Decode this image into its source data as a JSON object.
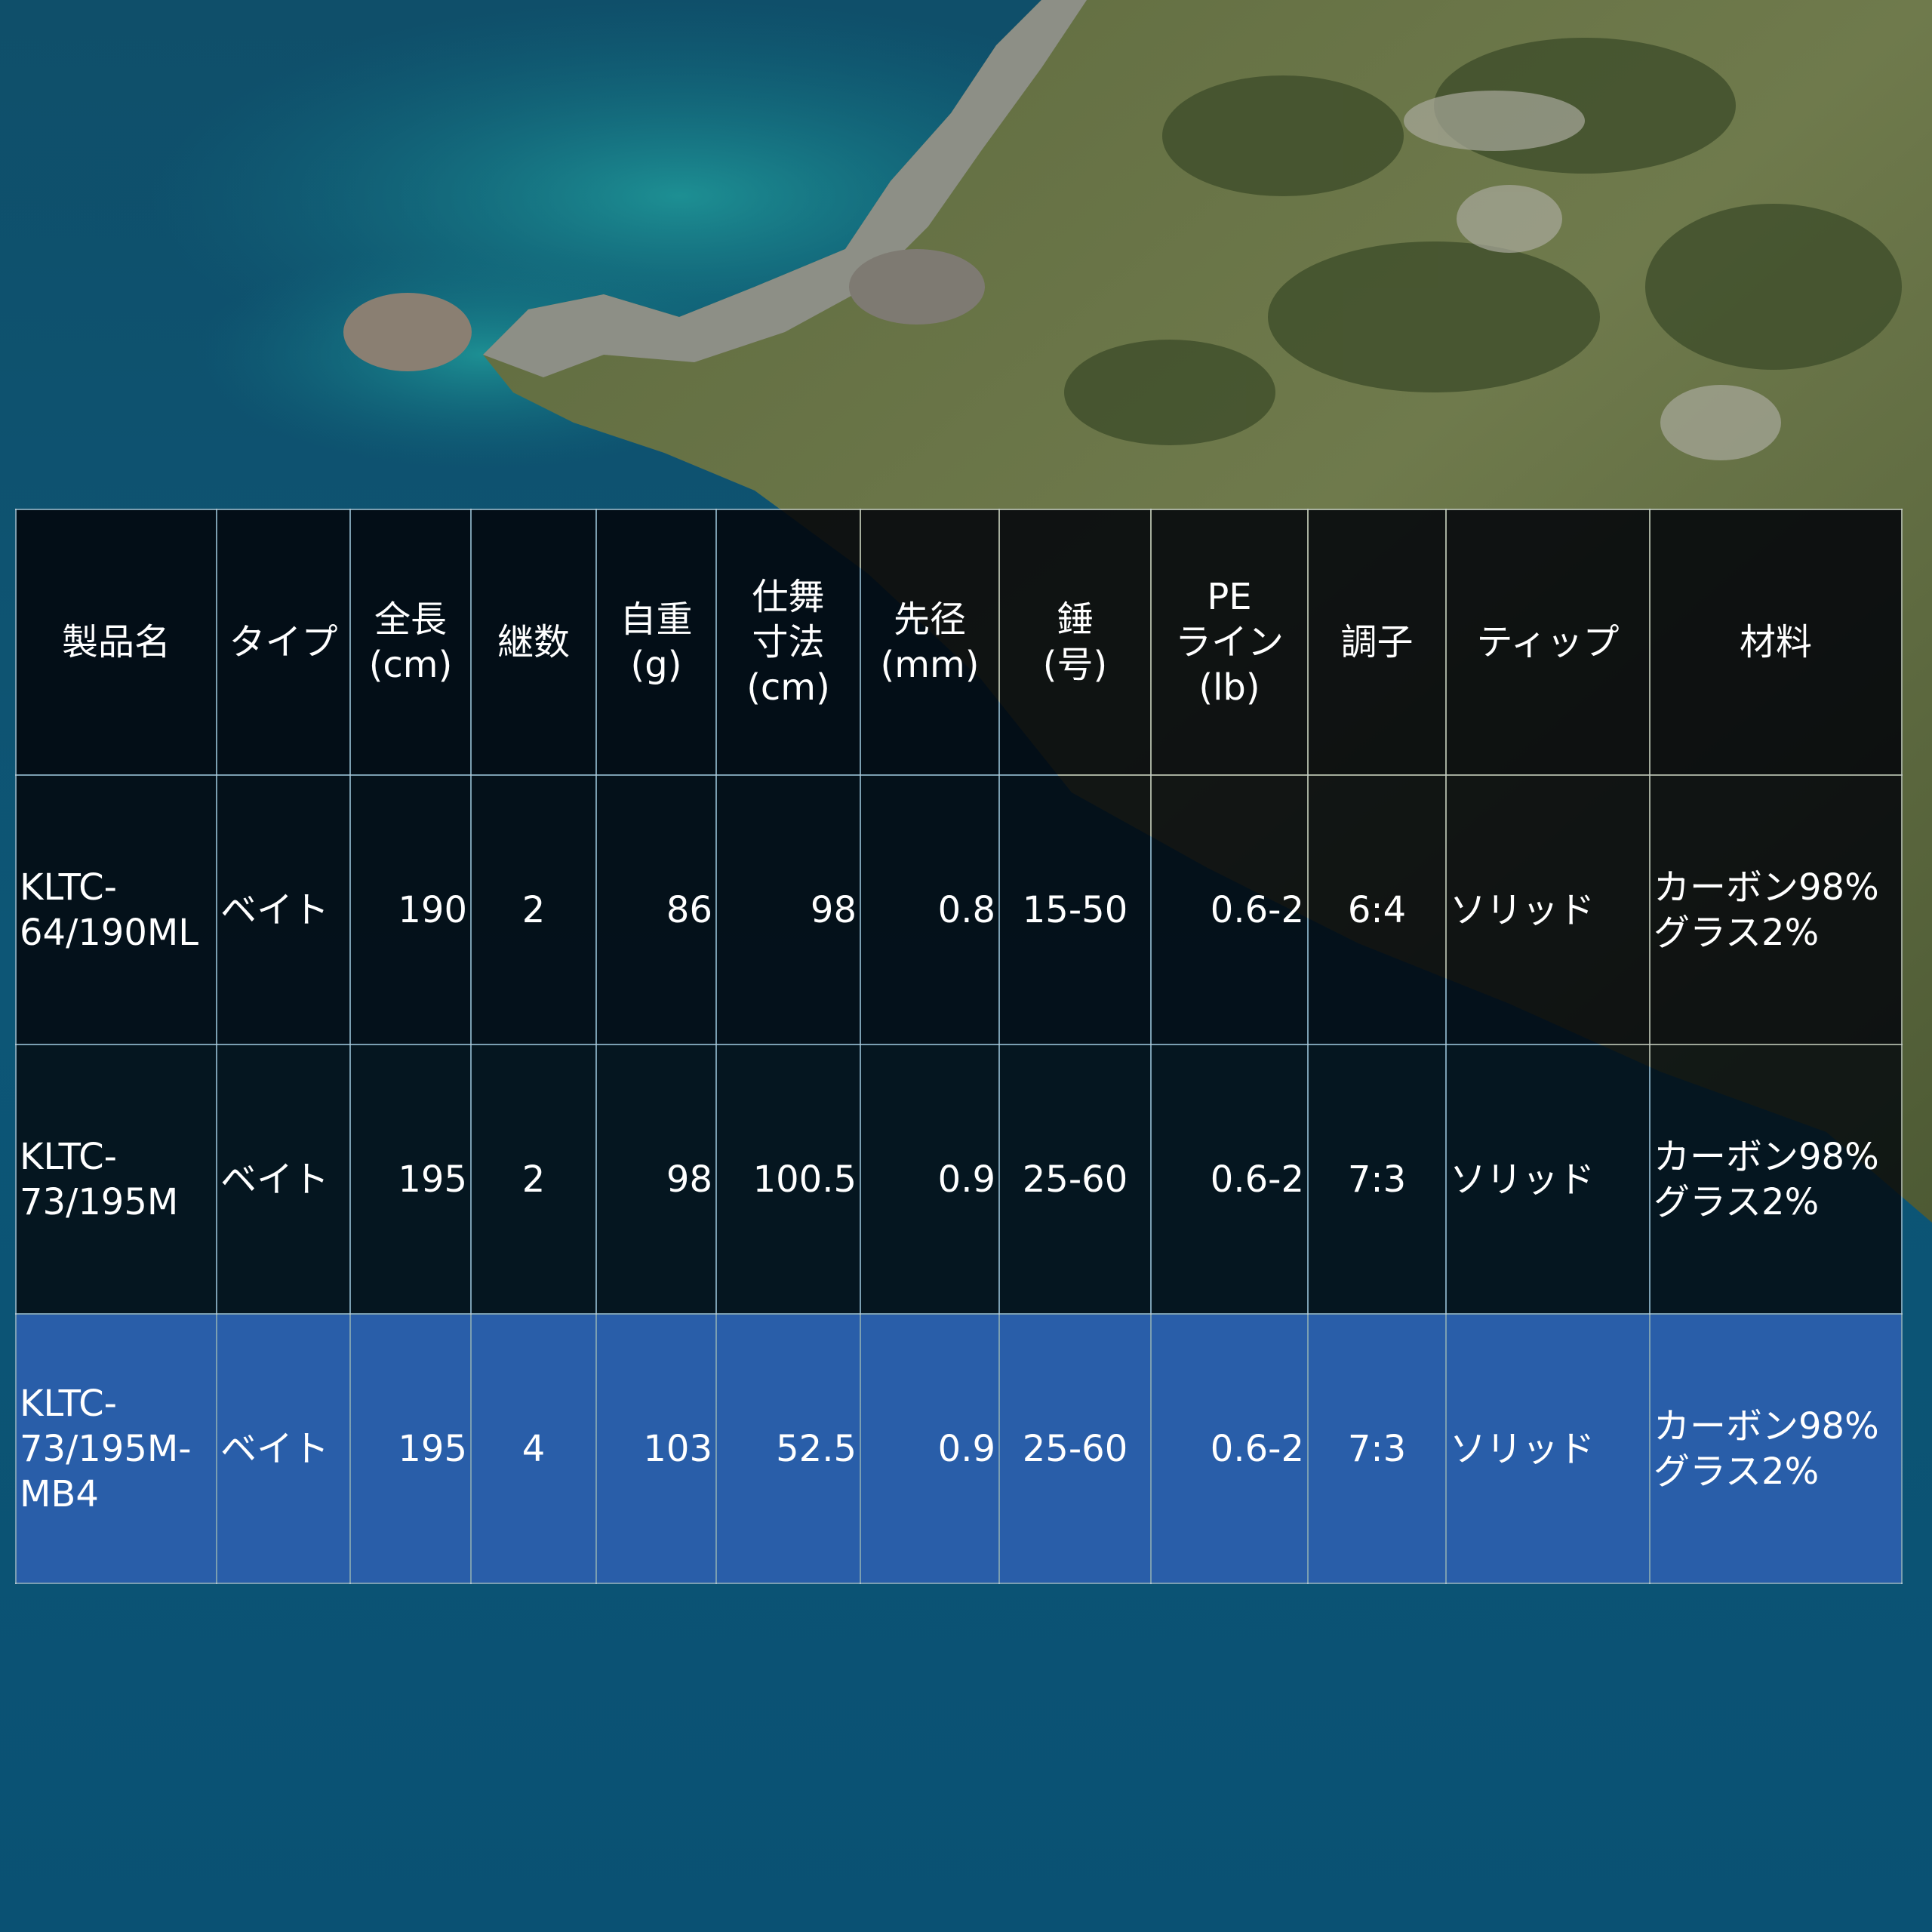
{
  "table": {
    "headers": [
      "製品名",
      "タイプ",
      "全長\n(cm)",
      "継数",
      "自重\n(g)",
      "仕舞\n寸法\n(cm)",
      "先径\n(mm)",
      "錘\n(号)",
      "PE\nライン\n(lb)",
      "調子",
      "ティップ",
      "材料"
    ],
    "rows": [
      [
        "KLTC-\n64/190ML",
        "ベイト",
        "190",
        "2",
        "86",
        "98",
        "0.8",
        "15-50",
        "0.6-2",
        "6:4",
        "ソリッド",
        "カーボン98%\nグラス2%"
      ],
      [
        "KLTC-\n73/195M",
        "ベイト",
        "195",
        "2",
        "98",
        "100.5",
        "0.9",
        "25-60",
        "0.6-2",
        "7:3",
        "ソリッド",
        "カーボン98%\nグラス2%"
      ],
      [
        "KLTC-\n73/195M-\nMB4",
        "ベイト",
        "195",
        "4",
        "103",
        "52.5",
        "0.9",
        "25-60",
        "0.6-2",
        "7:3",
        "ソリッド",
        "カーボン98%\nグラス2%"
      ]
    ],
    "highlight_color": "#2E60B0",
    "dark_color": "#05080E"
  }
}
